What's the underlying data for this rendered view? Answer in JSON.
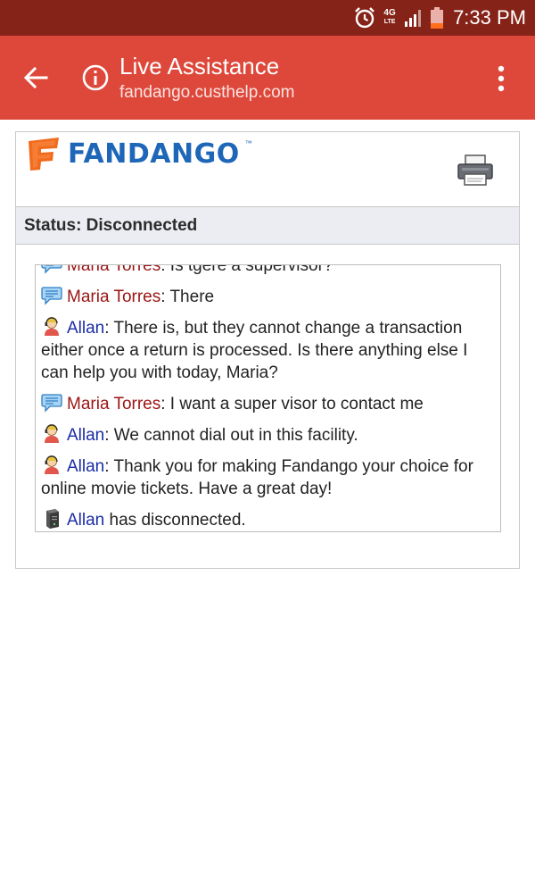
{
  "statusbar": {
    "network": "4G",
    "network_sub": "LTE",
    "time": "7:33 PM"
  },
  "appbar": {
    "title": "Live Assistance",
    "url": "fandango.custhelp.com"
  },
  "brand": {
    "name": "FANDANGO",
    "tm": "™"
  },
  "chat": {
    "status": "Status: Disconnected",
    "messages": [
      {
        "name": "Maria Torres",
        "text": ": Is tgere a supervisor?"
      },
      {
        "name": "Maria Torres",
        "text": ": There"
      },
      {
        "name": "Allan",
        "text": ": There is, but they cannot change a transaction either once a return is processed. Is there anything else I can help you with today, Maria?"
      },
      {
        "name": "Maria Torres",
        "text": ": I want a super visor to contact me"
      },
      {
        "name": "Allan",
        "text": ": We cannot dial out in this facility."
      },
      {
        "name": "Allan",
        "text": ": Thank you for making Fandango your choice for online movie tickets. Have a great day!"
      },
      {
        "name": "Allan",
        "text": " has disconnected."
      }
    ]
  },
  "colors": {
    "statusbar": "#862318",
    "appbar": "#de483b",
    "brand_orange": "#f26b1d",
    "brand_blue": "#1e66b8",
    "customer_name": "#9b1515",
    "agent_name": "#1a2da6"
  }
}
